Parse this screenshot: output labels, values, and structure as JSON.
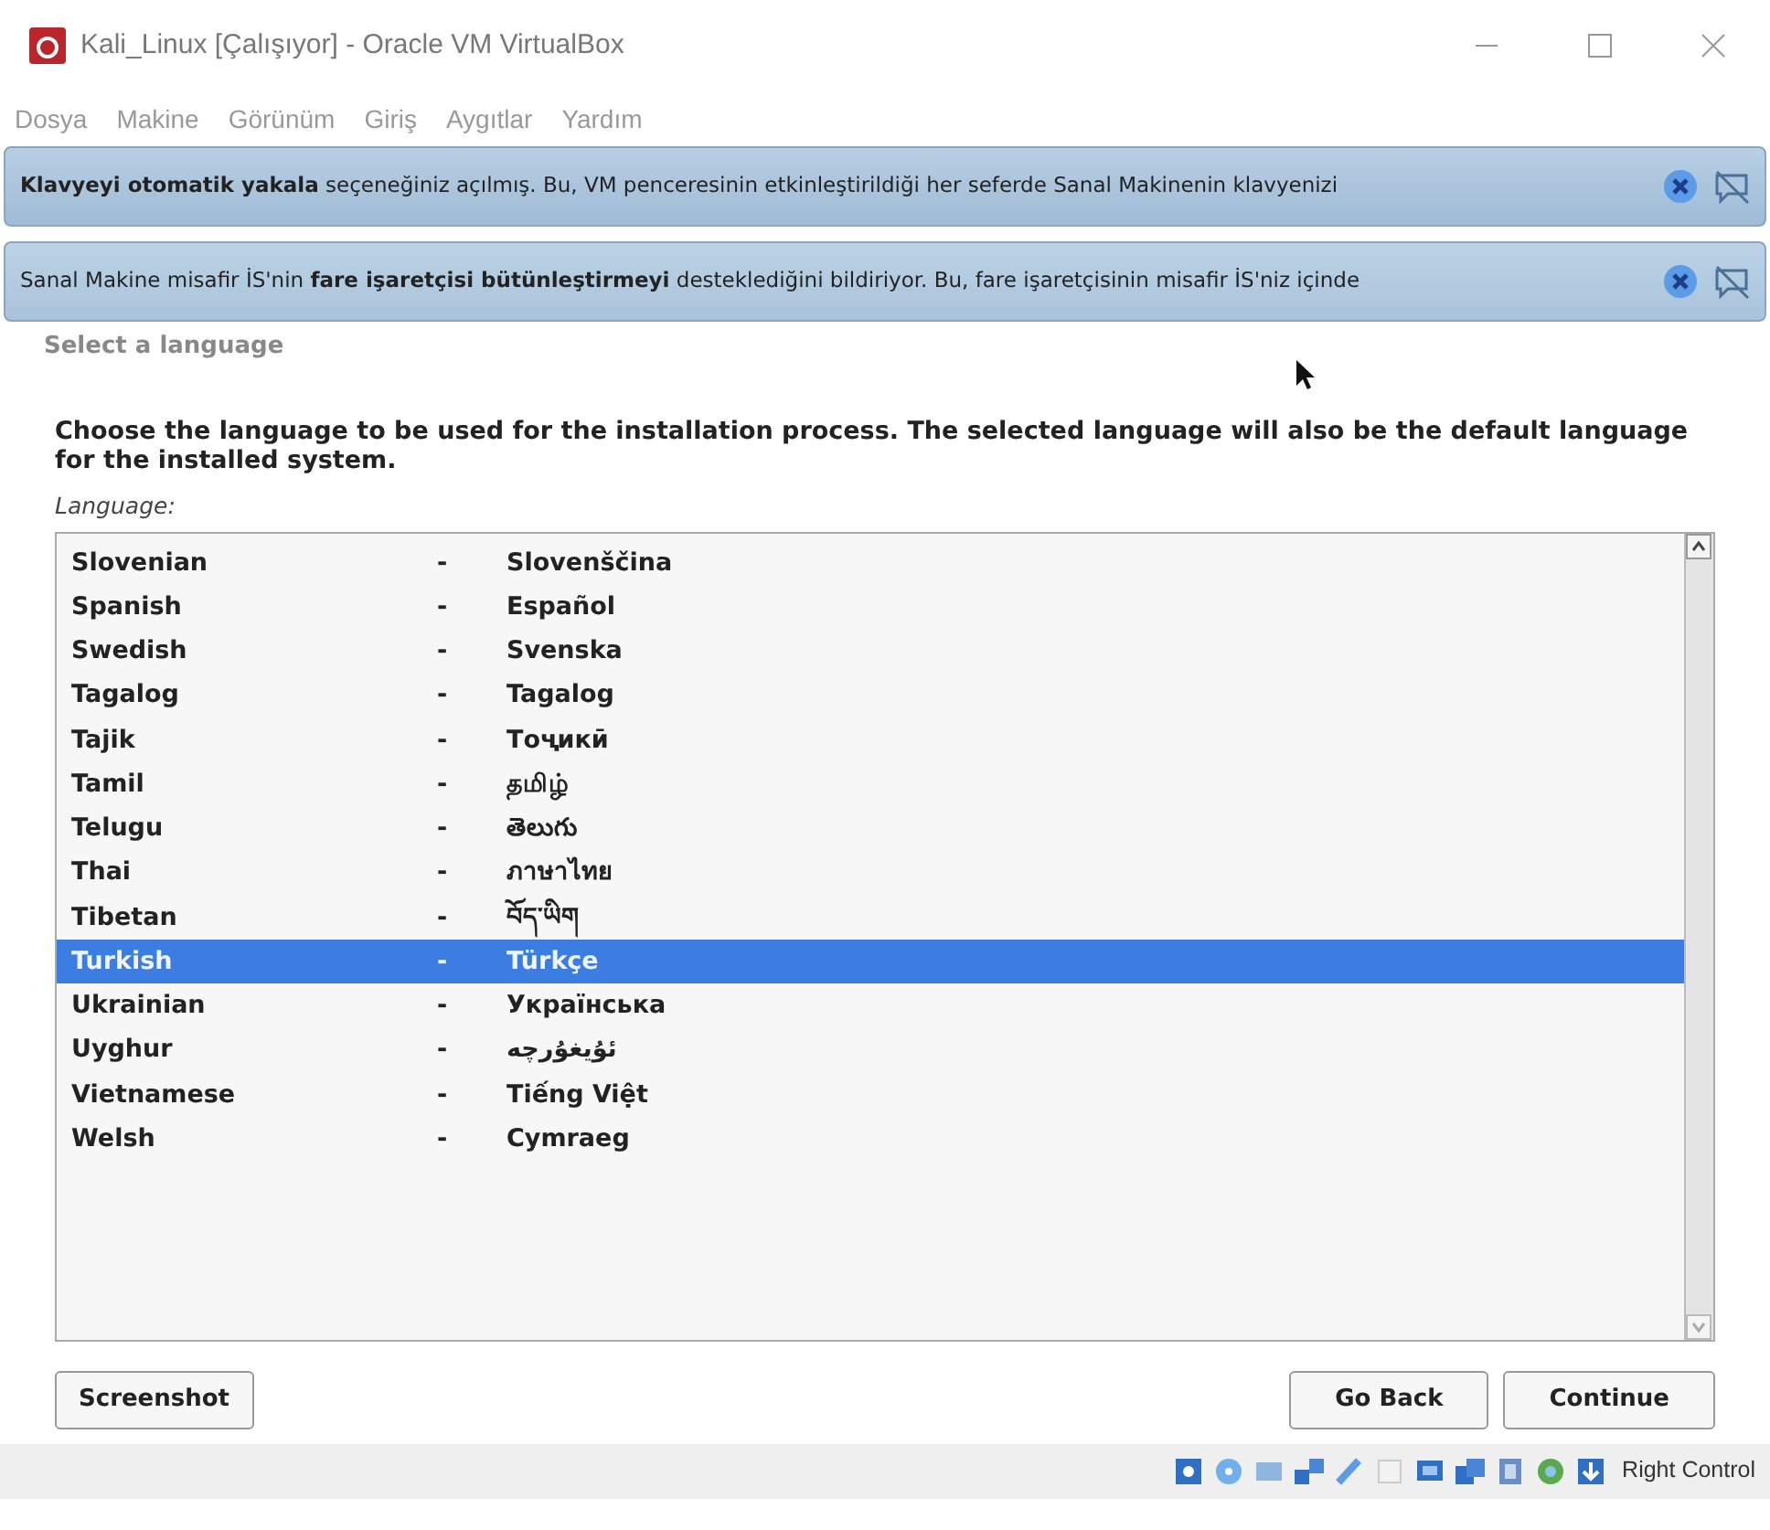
{
  "window": {
    "title": "Kali_Linux [Çalışıyor] - Oracle VM VirtualBox"
  },
  "menu": [
    "Dosya",
    "Makine",
    "Görünüm",
    "Giriş",
    "Aygıtlar",
    "Yardım"
  ],
  "banners": [
    {
      "text": "**Klavyeyi otomatik yakala** seçeneğiniz açılmış. Bu, VM penceresinin etkinleştirildiği her seferde Sanal Makinenin klavyenizi"
    },
    {
      "text": "Sanal Makine misafir İS'nin **fare işaretçisi bütünleştirmeyi** desteklediğini bildiriyor. Bu, fare işaretçisinin misafir İS'niz içinde"
    }
  ],
  "installer": {
    "step_title": "Select a language",
    "instructions": "Choose the language to be used for the installation process. The selected language will also be the default language for the installed system.",
    "list_label": "Language:",
    "languages": [
      {
        "name": "Slovenian",
        "separator": "-",
        "native": "Slovenščina",
        "selected": false
      },
      {
        "name": "Spanish",
        "separator": "-",
        "native": "Español",
        "selected": false
      },
      {
        "name": "Swedish",
        "separator": "-",
        "native": "Svenska",
        "selected": false
      },
      {
        "name": "Tagalog",
        "separator": "-",
        "native": "Tagalog",
        "selected": false
      },
      {
        "name": "Tajik",
        "separator": "-",
        "native": "Тоҷикӣ",
        "selected": false
      },
      {
        "name": "Tamil",
        "separator": "-",
        "native": "தமிழ்",
        "selected": false
      },
      {
        "name": "Telugu",
        "separator": "-",
        "native": "తెలుగు",
        "selected": false
      },
      {
        "name": "Thai",
        "separator": "-",
        "native": "ภาษาไทย",
        "selected": false
      },
      {
        "name": "Tibetan",
        "separator": "-",
        "native": "བོད་ཡིག",
        "selected": false
      },
      {
        "name": "Turkish",
        "separator": "-",
        "native": "Türkçe",
        "selected": true
      },
      {
        "name": "Ukrainian",
        "separator": "-",
        "native": "Українська",
        "selected": false
      },
      {
        "name": "Uyghur",
        "separator": "-",
        "native": "ئۇيغۇرچە",
        "selected": false
      },
      {
        "name": "Vietnamese",
        "separator": "-",
        "native": "Tiếng Việt",
        "selected": false
      },
      {
        "name": "Welsh",
        "separator": "-",
        "native": "Cymraeg",
        "selected": false
      }
    ],
    "buttons_left": [
      "Screenshot"
    ],
    "buttons_right": [
      "Go Back",
      "Continue"
    ]
  },
  "status_bar": {
    "host_key": "Right Control"
  }
}
